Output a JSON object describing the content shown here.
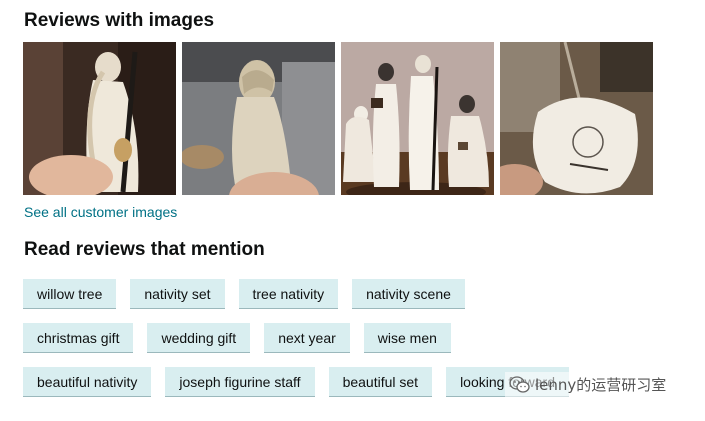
{
  "sections": {
    "images_title": "Reviews with images",
    "see_all_label": "See all customer images",
    "mention_title": "Read reviews that mention"
  },
  "thumbnails": [
    {
      "icon": "figurine-photo-1"
    },
    {
      "icon": "figurine-photo-2"
    },
    {
      "icon": "nativity-set-photo"
    },
    {
      "icon": "figurine-base-photo"
    }
  ],
  "chips": {
    "row1": [
      "willow tree",
      "nativity set",
      "tree nativity",
      "nativity scene"
    ],
    "row2": [
      "christmas gift",
      "wedding gift",
      "next year",
      "wise men"
    ],
    "row3": [
      "beautiful nativity",
      "joseph figurine staff",
      "beautiful set",
      "looking forward"
    ]
  },
  "watermark": {
    "text": "lenny的运营研习室"
  },
  "colors": {
    "link": "#007185",
    "chip_bg": "#d9eef0",
    "chip_border": "#9bb8bc"
  }
}
